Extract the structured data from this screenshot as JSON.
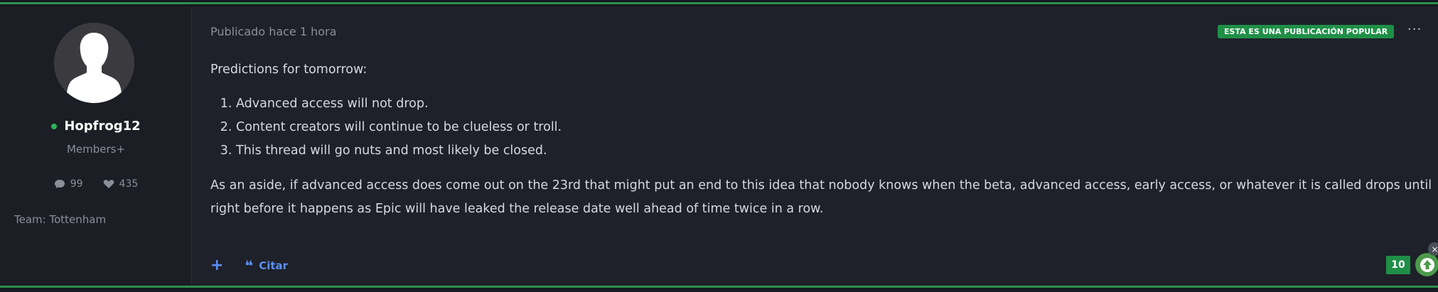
{
  "post": {
    "author": {
      "username": "Hopfrog12",
      "role": "Members+",
      "posts_count": "99",
      "likes_count": "435",
      "team": "Team: Tottenham",
      "online": true
    },
    "meta": "Publicado hace 1 hora",
    "badge": "ESTA ES UNA PUBLICACIÓN POPULAR",
    "menu_label": "···",
    "intro": "Predictions for tomorrow:",
    "list": [
      "Advanced access will not drop.",
      "Content creators will continue to be clueless or troll.",
      "This thread will go nuts and most likely be closed."
    ],
    "aside": "As an aside, if advanced access does come out on the 23rd that might put an end to this idea that nobody knows when the beta, advanced access, early access, or whatever it is called drops until right before it happens as Epic will have leaked the release date well ahead of time twice in a row.",
    "footer": {
      "add_label": "+",
      "quote_label": "Citar",
      "reaction_count": "10",
      "close_label": "×"
    }
  },
  "colors": {
    "accent_green": "#1f8f47",
    "link_blue": "#5b8df5",
    "background": "#1e2129"
  }
}
